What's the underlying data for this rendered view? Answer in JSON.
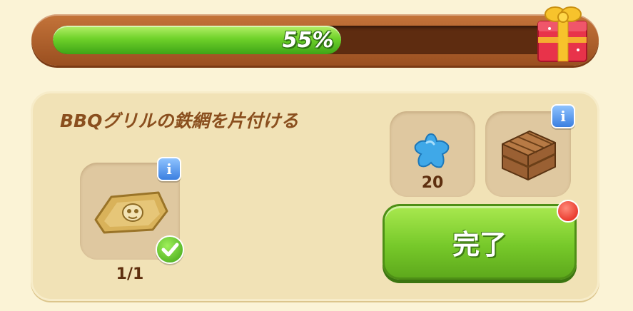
{
  "progress": {
    "percent_label": "55%",
    "value": 0.55,
    "reward_icon": "gift-box-icon"
  },
  "task": {
    "title": "BBQグリルの鉄網を片付ける",
    "required_item": {
      "icon": "cloth-sack-icon",
      "count_label": "1/1",
      "completed": true
    }
  },
  "rewards": [
    {
      "icon": "blue-star-icon",
      "amount_label": "20"
    },
    {
      "icon": "wooden-crate-icon",
      "amount_label": ""
    }
  ],
  "complete_button": {
    "label": "完了"
  },
  "colors": {
    "progress_fill": "#6fd22a",
    "button_green": "#77c92a",
    "title_brown": "#8a4f1e",
    "notification_red": "#e11b10"
  }
}
